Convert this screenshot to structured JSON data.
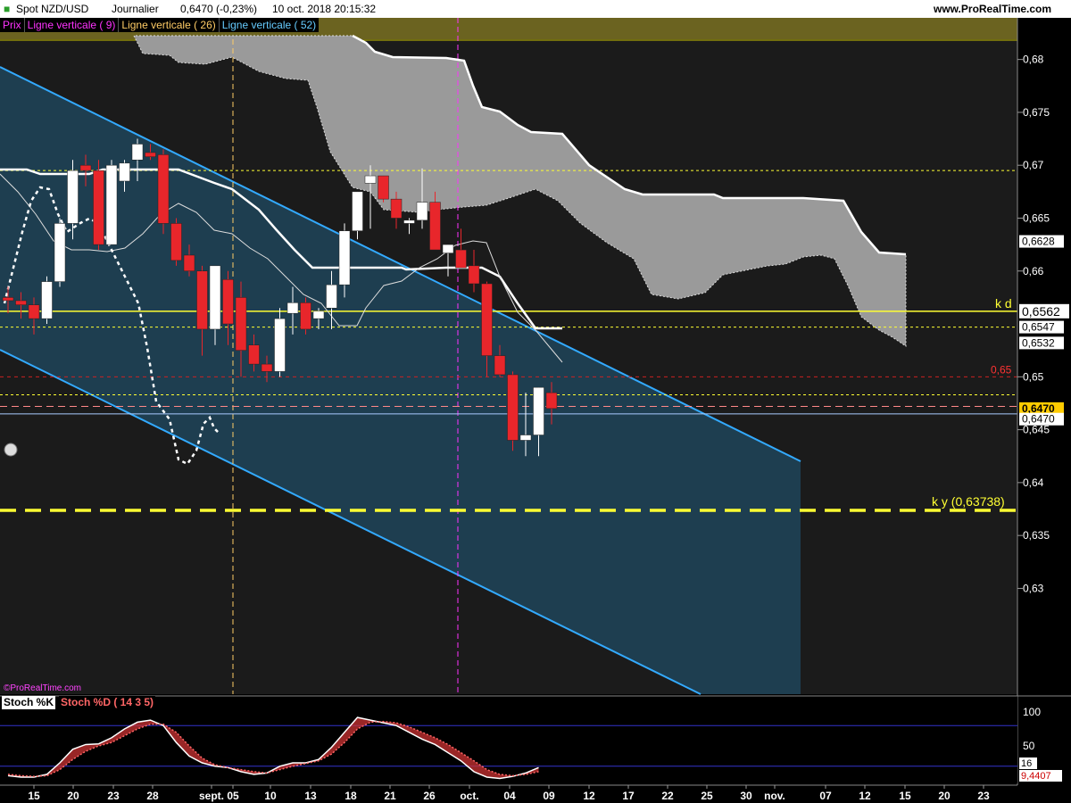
{
  "header": {
    "instrument": "Spot NZD/USD",
    "timeframe": "Journalier",
    "last": "0,6470 (-0,23%)",
    "datetime": "10 oct. 2018 20:15:32",
    "site": "www.ProRealTime.com"
  },
  "legend": [
    {
      "label": "Prix",
      "color": "#ff33ff"
    },
    {
      "label": "Ligne verticale ( 9)",
      "color": "#ff33ff"
    },
    {
      "label": "Ligne verticale ( 26)",
      "color": "#ffcc66"
    },
    {
      "label": "Ligne verticale ( 52)",
      "color": "#66ccff"
    }
  ],
  "watermark": "©ProRealTime.com",
  "colors": {
    "up": "#ffffff",
    "down": "#e8262b",
    "cloud": "#9a9a9a",
    "channel": "#33aaff",
    "channel_fill": "#1f4257",
    "level_yellow": "#ffff33",
    "kijun": "#ffffff",
    "stoch_k": "#ffffff",
    "stoch_d": "#ff6666"
  },
  "chart_data": [
    {
      "type": "candlestick",
      "title": "Spot NZD/USD Journalier",
      "ylim": [
        0.62,
        0.6825
      ],
      "y_ticks": [
        "0,68",
        "0,675",
        "0,67",
        "0,665",
        "0,66",
        "0,65",
        "0,645",
        "0,64",
        "0,635",
        "0,63"
      ],
      "x_ticks": [
        "15",
        "20",
        "23",
        "28",
        "sept.",
        "05",
        "10",
        "13",
        "18",
        "21",
        "26",
        "oct.",
        "04",
        "09",
        "12",
        "17",
        "22",
        "25",
        "30",
        "nov.",
        "07",
        "12",
        "15",
        "20",
        "23"
      ],
      "dates": [
        "08-14",
        "08-15",
        "08-16",
        "08-17",
        "08-20",
        "08-21",
        "08-22",
        "08-23",
        "08-24",
        "08-27",
        "08-28",
        "08-29",
        "08-30",
        "08-31",
        "09-03",
        "09-04",
        "09-05",
        "09-06",
        "09-07",
        "09-10",
        "09-11",
        "09-12",
        "09-13",
        "09-14",
        "09-17",
        "09-18",
        "09-19",
        "09-20",
        "09-21",
        "09-24",
        "09-25",
        "09-26",
        "09-27",
        "09-28",
        "10-01",
        "10-02",
        "10-03",
        "10-04",
        "10-05",
        "10-08",
        "10-09",
        "10-10"
      ],
      "ohlc": [
        [
          0.6575,
          0.6585,
          0.656,
          0.6572
        ],
        [
          0.6572,
          0.658,
          0.6555,
          0.6568
        ],
        [
          0.6568,
          0.6575,
          0.654,
          0.6555
        ],
        [
          0.6555,
          0.6595,
          0.655,
          0.659
        ],
        [
          0.659,
          0.665,
          0.6585,
          0.6645
        ],
        [
          0.6645,
          0.6705,
          0.663,
          0.6695
        ],
        [
          0.67,
          0.671,
          0.668,
          0.6695
        ],
        [
          0.6695,
          0.6705,
          0.662,
          0.6625
        ],
        [
          0.6625,
          0.6705,
          0.6625,
          0.67
        ],
        [
          0.6685,
          0.6705,
          0.6675,
          0.6702
        ],
        [
          0.6705,
          0.6725,
          0.6685,
          0.672
        ],
        [
          0.6712,
          0.672,
          0.6705,
          0.6708
        ],
        [
          0.671,
          0.6715,
          0.6635,
          0.6645
        ],
        [
          0.6645,
          0.665,
          0.6605,
          0.661
        ],
        [
          0.6615,
          0.6625,
          0.6595,
          0.66
        ],
        [
          0.66,
          0.6605,
          0.652,
          0.6545
        ],
        [
          0.6545,
          0.6605,
          0.653,
          0.6605
        ],
        [
          0.6592,
          0.66,
          0.653,
          0.655
        ],
        [
          0.6575,
          0.659,
          0.65,
          0.6525
        ],
        [
          0.653,
          0.654,
          0.6505,
          0.6512
        ],
        [
          0.6512,
          0.652,
          0.6495,
          0.6505
        ],
        [
          0.6505,
          0.6565,
          0.65,
          0.6555
        ],
        [
          0.656,
          0.6585,
          0.654,
          0.657
        ],
        [
          0.657,
          0.6575,
          0.654,
          0.6545
        ],
        [
          0.6555,
          0.6565,
          0.6545,
          0.6562
        ],
        [
          0.6565,
          0.66,
          0.6545,
          0.6587
        ],
        [
          0.6587,
          0.6645,
          0.6575,
          0.6638
        ],
        [
          0.6638,
          0.6675,
          0.663,
          0.6675
        ],
        [
          0.6683,
          0.67,
          0.664,
          0.669
        ],
        [
          0.669,
          0.669,
          0.6665,
          0.6668
        ],
        [
          0.6668,
          0.6675,
          0.664,
          0.665
        ],
        [
          0.6645,
          0.665,
          0.6635,
          0.6648
        ],
        [
          0.6648,
          0.6697,
          0.664,
          0.6665
        ],
        [
          0.6665,
          0.6675,
          0.662,
          0.662
        ],
        [
          0.6617,
          0.6625,
          0.6595,
          0.6625
        ],
        [
          0.662,
          0.664,
          0.6605,
          0.6603
        ],
        [
          0.6605,
          0.662,
          0.658,
          0.6588
        ],
        [
          0.6588,
          0.659,
          0.65,
          0.652
        ],
        [
          0.652,
          0.653,
          0.65,
          0.6502
        ],
        [
          0.6502,
          0.6505,
          0.643,
          0.644
        ],
        [
          0.644,
          0.6485,
          0.6425,
          0.6445
        ],
        [
          0.6445,
          0.649,
          0.6425,
          0.649
        ],
        [
          0.6485,
          0.6495,
          0.6455,
          0.647
        ]
      ],
      "levels": [
        {
          "label": "k d",
          "value": 0.6562,
          "value_label": "0,6562",
          "style": "solid-yellow"
        },
        {
          "label": "k y (0,63738)",
          "value": 0.63738,
          "style": "dashed-yellow"
        },
        {
          "label": "0,65",
          "value": 0.65,
          "style": "dashed-red"
        }
      ],
      "price_tags": [
        {
          "value": 0.6628,
          "label": "0,6628",
          "style": "white"
        },
        {
          "value": 0.6547,
          "label": "0,6547",
          "style": "white"
        },
        {
          "value": 0.6532,
          "label": "0,6532",
          "style": "white"
        },
        {
          "value": 0.647,
          "label": "0,6470",
          "style": "yellow"
        },
        {
          "value": 0.646,
          "label": "0,6470",
          "style": "white"
        }
      ]
    },
    {
      "type": "line",
      "title": "Stoch %K  Stoch %D ( 14 3 5)",
      "series": [
        {
          "name": "Stoch %K",
          "values": [
            6,
            4,
            4,
            8,
            25,
            45,
            52,
            53,
            62,
            75,
            85,
            88,
            80,
            55,
            35,
            25,
            20,
            18,
            12,
            8,
            10,
            20,
            25,
            25,
            30,
            48,
            70,
            92,
            88,
            84,
            80,
            70,
            60,
            52,
            40,
            28,
            12,
            4,
            2,
            5,
            10,
            18
          ]
        },
        {
          "name": "Stoch %D",
          "values": [
            8,
            6,
            5,
            6,
            15,
            30,
            42,
            50,
            55,
            65,
            75,
            82,
            82,
            70,
            50,
            32,
            22,
            18,
            15,
            12,
            10,
            15,
            20,
            24,
            28,
            38,
            55,
            75,
            85,
            86,
            84,
            78,
            70,
            62,
            52,
            40,
            28,
            15,
            8,
            6,
            8,
            12
          ]
        }
      ],
      "ylim": [
        0,
        100
      ],
      "y_ticks": [
        "100",
        "50"
      ],
      "value_tags": [
        "16",
        "9,4407"
      ]
    }
  ]
}
